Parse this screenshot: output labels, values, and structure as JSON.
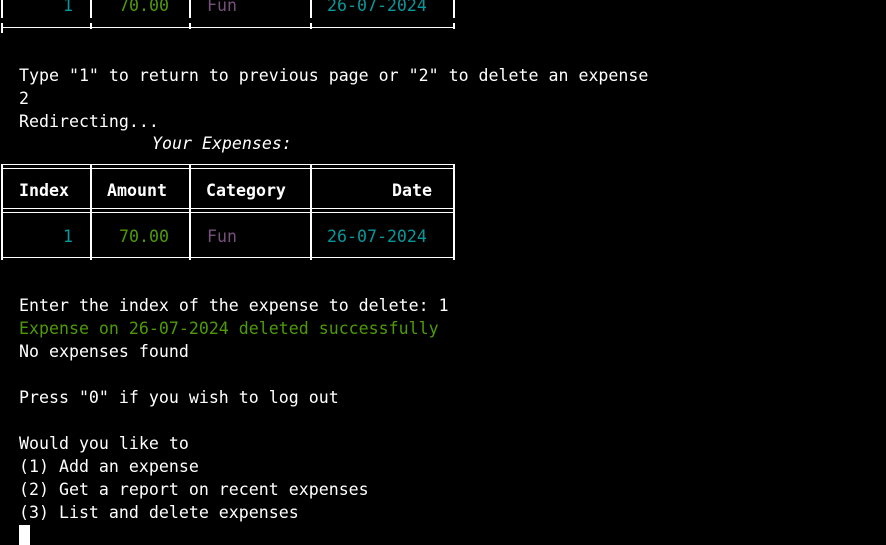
{
  "top_table_row": {
    "index": "1",
    "amount": "70.00",
    "category": "Fun",
    "date": "26-07-2024"
  },
  "prompt_line": "Type \"1\" to return to previous page or \"2\" to delete an expense",
  "user_input_1": "2",
  "redirecting": "Redirecting...",
  "table_title": "Your Expenses:",
  "table": {
    "headers": {
      "index": "Index",
      "amount": "Amount",
      "category": "Category",
      "date": "Date"
    },
    "row": {
      "index": "1",
      "amount": "70.00",
      "category": "Fun",
      "date": "26-07-2024"
    }
  },
  "delete_prompt": "Enter the index of the expense to delete: 1",
  "delete_success": "Expense on 26-07-2024 deleted successfully",
  "no_expenses": "No expenses found",
  "logout_prompt": "Press \"0\" if you wish to log out",
  "menu": {
    "question": "Would you like to",
    "options": [
      "(1) Add an expense",
      "(2) Get a report on recent expenses",
      "(3) List and delete expenses"
    ]
  },
  "colors": {
    "background": "#000000",
    "text": "#ffffff",
    "amount": "#4e9a06",
    "category": "#75507b",
    "date": "#06989a",
    "success": "#4e9a06"
  }
}
